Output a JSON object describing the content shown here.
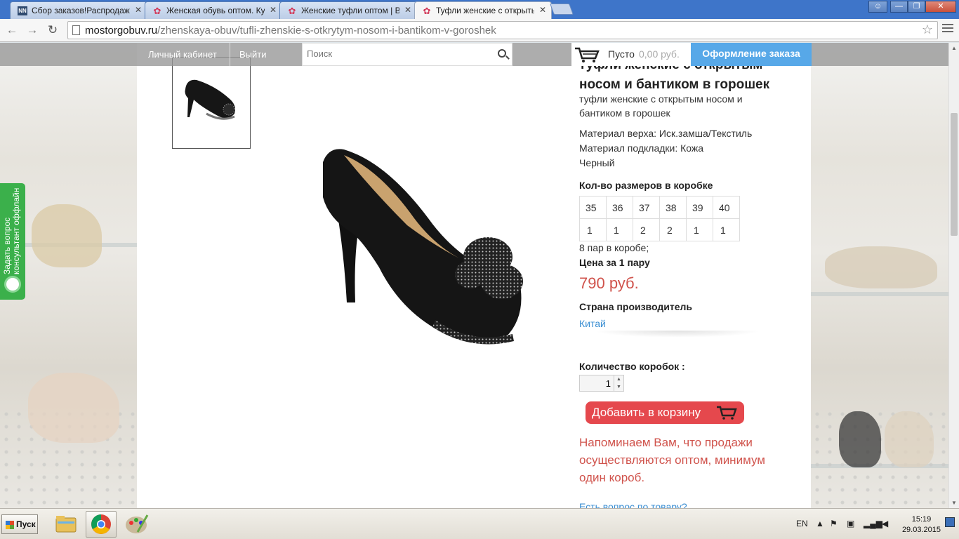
{
  "browser": {
    "tabs": [
      {
        "title": "Сбор заказов!Распродажа д",
        "favicon": "nn-icon"
      },
      {
        "title": "Женская обувь оптом. Куп",
        "favicon": "flower-icon"
      },
      {
        "title": "Женские туфли оптом | Ве",
        "favicon": "flower-icon"
      },
      {
        "title": "Туфли женские с открыты",
        "favicon": "flower-icon"
      }
    ],
    "url_host": "mostorgobuv.ru",
    "url_path": "/zhenskaya-obuv/tufli-zhenskie-s-otkrytym-nosom-i-bantikom-v-goroshek"
  },
  "site": {
    "account_link": "Личный кабинет",
    "logout_link": "Выйти",
    "search_placeholder": "Поиск",
    "cart_label": "Пусто",
    "cart_sum": "0,00 руб.",
    "checkout": "Оформление заказа"
  },
  "ask_widget": {
    "line1": "Задать вопрос",
    "line2": "консультант оффлайн"
  },
  "product": {
    "title": "туфли женские с открытым носом и бантиком в горошек",
    "subtitle": "туфли женские с открытым носом и бантиком в горошек",
    "material_top": "Материал верха: Иск.замша/Текстиль",
    "material_lining": "Материал подкладки: Кожа",
    "color": "Черный",
    "sizes_heading": "Кол-во размеров в коробке",
    "sizes": [
      "35",
      "36",
      "37",
      "38",
      "39",
      "40"
    ],
    "size_counts": [
      "1",
      "1",
      "2",
      "2",
      "1",
      "1"
    ],
    "pairs_per_box": "8 пар в коробе;",
    "price_heading": "Цена за 1 пару",
    "price": "790 руб.",
    "country_heading": "Страна производитель",
    "country": "Китай",
    "qty_label": "Количество коробок :",
    "qty_value": "1",
    "add_to_cart": "Добавить в корзину",
    "notice": "Напоминаем Вам, что продажи осуществляются оптом, минимум один короб.",
    "question_link": "Есть вопрос по товару?"
  },
  "taskbar": {
    "start": "Пуск",
    "lang": "EN",
    "time": "15:19",
    "date": "29.03.2015"
  },
  "colors": {
    "accent_blue": "#57a8e8",
    "price_red": "#d0534c",
    "button_red": "#e5484d",
    "widget_green": "#3bb04b",
    "link_blue": "#3a8ed2"
  }
}
